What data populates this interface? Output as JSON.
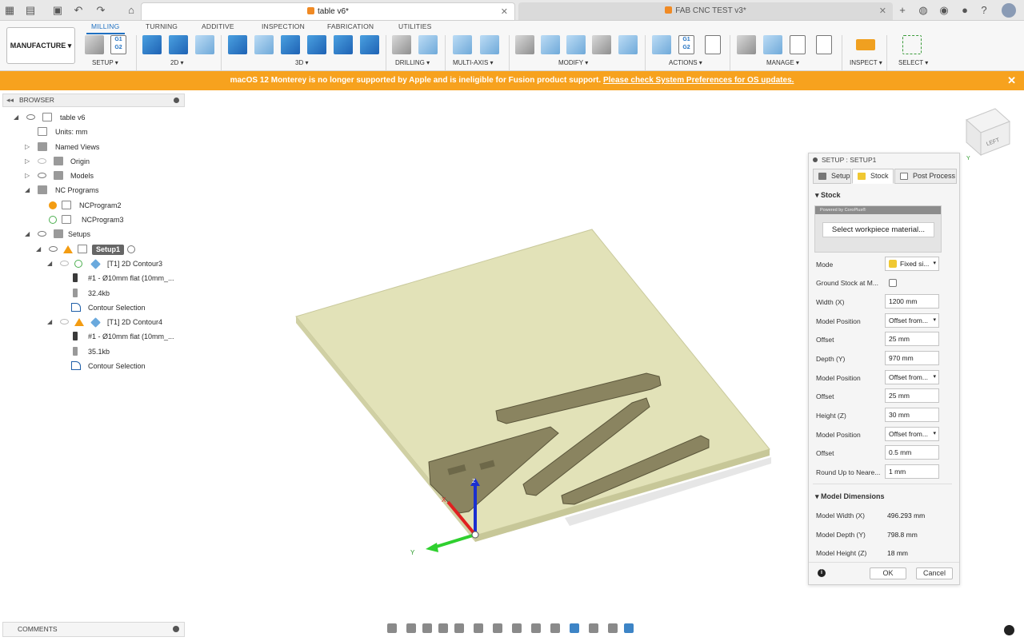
{
  "titlebar": {
    "active_tab": "table v6*",
    "inactive_tab": "FAB CNC TEST v3*",
    "new_tab_icon": "plus-icon"
  },
  "ribbon": {
    "tabs": [
      "MILLING",
      "TURNING",
      "ADDITIVE",
      "INSPECTION",
      "FABRICATION",
      "UTILITIES"
    ],
    "workspace": "MANUFACTURE",
    "groups": [
      "SETUP ▾",
      "2D ▾",
      "3D ▾",
      "DRILLING ▾",
      "MULTI-AXIS ▾",
      "MODIFY ▾",
      "ACTIONS ▾",
      "MANAGE ▾",
      "INSPECT ▾",
      "SELECT ▾"
    ],
    "g1g2_label": "G1\nG2"
  },
  "banner": {
    "text": "macOS 12 Monterey is no longer supported by Apple and is ineligible for Fusion product support.",
    "link": "Please check System Preferences for OS updates.",
    "color": "#f7a21e"
  },
  "browser": {
    "title": "BROWSER",
    "items": [
      {
        "label": "table v6"
      },
      {
        "label": "Units: mm"
      },
      {
        "label": "Named Views"
      },
      {
        "label": "Origin"
      },
      {
        "label": "Models"
      },
      {
        "label": "NC Programs"
      },
      {
        "label": "NCProgram2"
      },
      {
        "label": "NCProgram3"
      },
      {
        "label": "Setups"
      },
      {
        "label": "Setup1"
      },
      {
        "label": "[T1] 2D Contour3"
      },
      {
        "label": "#1 - Ø10mm flat (10mm_..."
      },
      {
        "label": "32.4kb"
      },
      {
        "label": "Contour Selection"
      },
      {
        "label": "[T1] 2D Contour4"
      },
      {
        "label": "#1 - Ø10mm flat (10mm_..."
      },
      {
        "label": "35.1kb"
      },
      {
        "label": "Contour Selection"
      }
    ]
  },
  "comments": {
    "title": "COMMENTS"
  },
  "viewcube": {
    "face": "LEFT"
  },
  "axes": {
    "x": "X",
    "y": "Y",
    "z": "Z"
  },
  "dialog": {
    "title": "SETUP : SETUP1",
    "tabs": [
      "Setup",
      "Stock",
      "Post Process"
    ],
    "stock_section": "Stock",
    "powered_by": "Powered by CoroPlus®",
    "select_material": "Select workpiece material...",
    "fields": [
      {
        "label": "Mode",
        "value": "Fixed si...",
        "type": "select"
      },
      {
        "label": "Ground Stock at M...",
        "value": "",
        "type": "checkbox"
      },
      {
        "label": "Width (X)",
        "value": "1200 mm",
        "type": "input"
      },
      {
        "label": "Model Position",
        "value": "Offset from...",
        "type": "select"
      },
      {
        "label": "Offset",
        "value": "25 mm",
        "type": "input"
      },
      {
        "label": "Depth (Y)",
        "value": "970 mm",
        "type": "input"
      },
      {
        "label": "Model Position",
        "value": "Offset from...",
        "type": "select"
      },
      {
        "label": "Offset",
        "value": "25 mm",
        "type": "input"
      },
      {
        "label": "Height (Z)",
        "value": "30 mm",
        "type": "input"
      },
      {
        "label": "Model Position",
        "value": "Offset from...",
        "type": "select"
      },
      {
        "label": "Offset",
        "value": "0.5 mm",
        "type": "input"
      },
      {
        "label": "Round Up to Neare...",
        "value": "1 mm",
        "type": "input"
      }
    ],
    "dims_section": "Model Dimensions",
    "dims": [
      {
        "label": "Model Width (X)",
        "value": "496.293 mm"
      },
      {
        "label": "Model Depth (Y)",
        "value": "798.8 mm"
      },
      {
        "label": "Model Height (Z)",
        "value": "18 mm"
      }
    ],
    "ok": "OK",
    "cancel": "Cancel"
  },
  "colors": {
    "accent": "#1f70c1",
    "stock_fill": "#e2e2b8",
    "part_fill": "#8a8460"
  }
}
